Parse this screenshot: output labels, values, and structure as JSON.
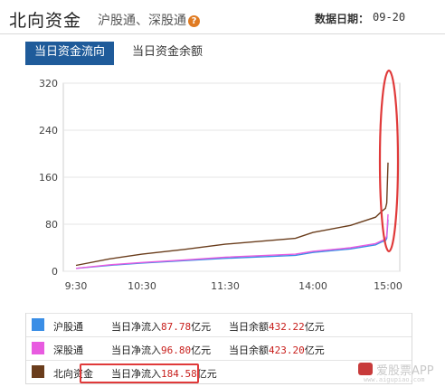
{
  "header": {
    "title": "北向资金",
    "subtitle": "沪股通、深股通",
    "help_icon": "question-icon",
    "date_label": "数据日期：",
    "date_value": "09-20"
  },
  "tabs": [
    {
      "label": "当日资金流向",
      "active": true
    },
    {
      "label": "当日资金余额",
      "active": false
    }
  ],
  "chart_data": {
    "type": "line",
    "x_ticks": [
      "9:30",
      "10:30",
      "11:30",
      "14:00",
      "15:00"
    ],
    "y_ticks": [
      "0",
      "80",
      "160",
      "240",
      "320"
    ],
    "ylim": [
      0,
      320
    ],
    "grid": "horizontal",
    "series": [
      {
        "name": "沪股通",
        "color": "#3a8ee6",
        "x": [
          "9:30",
          "10:00",
          "10:30",
          "11:00",
          "11:30",
          "13:30",
          "14:00",
          "14:30",
          "14:50",
          "14:55",
          "14:58",
          "14:59",
          "15:00"
        ],
        "values": [
          5,
          10,
          14,
          18,
          22,
          27,
          32,
          38,
          45,
          50,
          52,
          56,
          88
        ]
      },
      {
        "name": "深股通",
        "color": "#e85be0",
        "x": [
          "9:30",
          "10:00",
          "10:30",
          "11:00",
          "11:30",
          "13:30",
          "14:00",
          "14:30",
          "14:50",
          "14:55",
          "14:58",
          "14:59",
          "15:00"
        ],
        "values": [
          5,
          11,
          15,
          19,
          24,
          29,
          34,
          40,
          47,
          52,
          55,
          60,
          97
        ]
      },
      {
        "name": "北向资金",
        "color": "#6a3d1c",
        "x": [
          "9:30",
          "10:00",
          "10:30",
          "11:00",
          "11:30",
          "13:30",
          "14:00",
          "14:30",
          "14:50",
          "14:55",
          "14:58",
          "14:59",
          "15:00"
        ],
        "values": [
          10,
          21,
          29,
          37,
          46,
          56,
          66,
          78,
          92,
          102,
          107,
          116,
          185
        ]
      }
    ]
  },
  "legend": [
    {
      "name": "沪股通",
      "color": "#3a8ee6",
      "inflow_label": "当日净流入",
      "inflow": "87.78",
      "unit": "亿元",
      "balance_label": "当日余额",
      "balance": "432.22"
    },
    {
      "name": "深股通",
      "color": "#e85be0",
      "inflow_label": "当日净流入",
      "inflow": "96.80",
      "unit": "亿元",
      "balance_label": "当日余额",
      "balance": "423.20"
    },
    {
      "name": "北向资金",
      "color": "#6a3d1c",
      "inflow_label": "当日净流入",
      "inflow": "184.58",
      "unit": "亿元"
    }
  ],
  "watermark": {
    "text": "爱股票APP",
    "url": "www.aigupiao.com"
  }
}
